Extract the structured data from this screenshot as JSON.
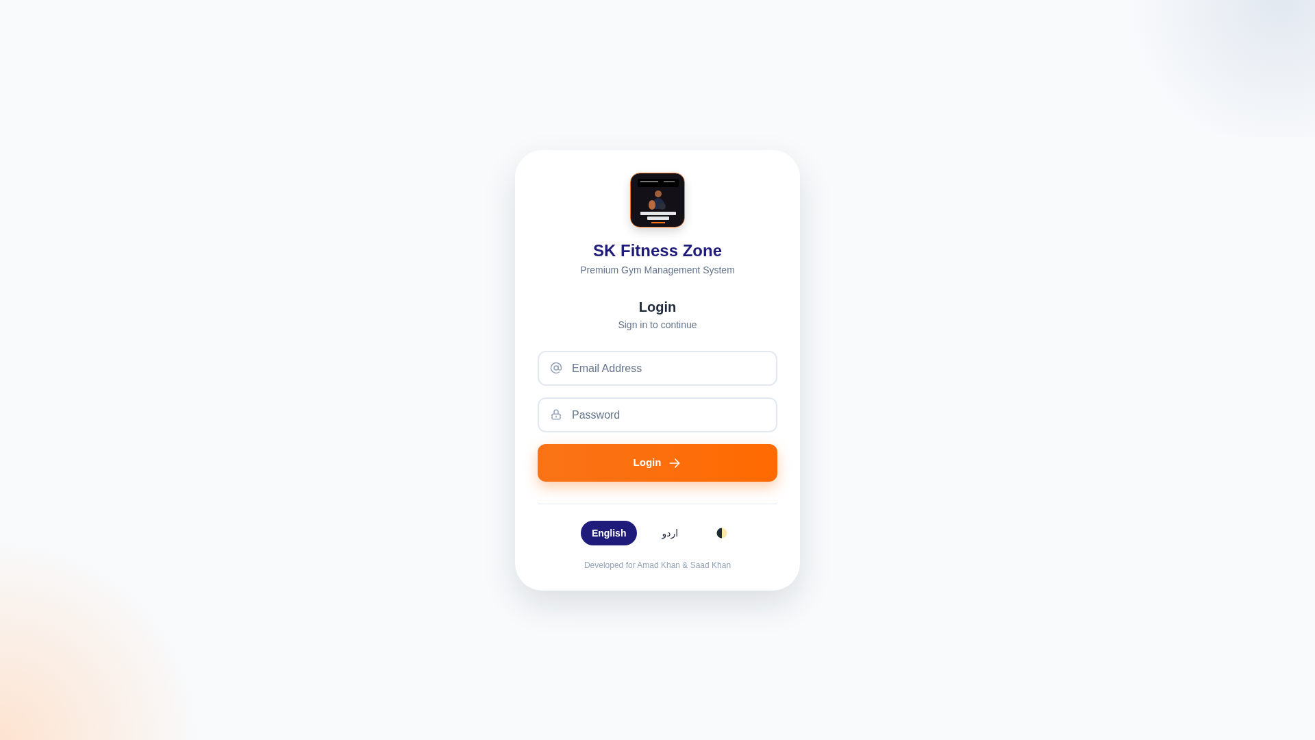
{
  "brand": {
    "title": "SK Fitness Zone",
    "subtitle": "Premium Gym Management System"
  },
  "form": {
    "heading": "Login",
    "subheading": "Sign in to continue",
    "fields": [
      {
        "kind": "email",
        "placeholder": "Email Address"
      },
      {
        "kind": "password",
        "placeholder": "Password"
      }
    ],
    "submit": "Login"
  },
  "languages": [
    {
      "label": "English",
      "selected": true
    },
    {
      "label": "اردو",
      "selected": false
    }
  ],
  "footer": "Developed for Amad Khan & Saad Khan"
}
